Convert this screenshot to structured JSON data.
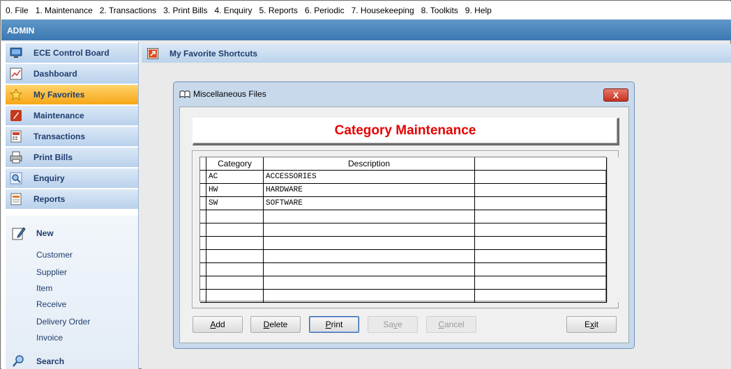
{
  "menu": {
    "items": [
      "0. File",
      "1. Maintenance",
      "2. Transactions",
      "3. Print Bills",
      "4. Enquiry",
      "5. Reports",
      "6. Periodic",
      "7. Housekeeping",
      "8. Toolkits",
      "9. Help"
    ]
  },
  "user_bar": {
    "username": "ADMIN"
  },
  "sidebar": {
    "items": [
      {
        "label": "ECE Control Board",
        "icon": "monitor-icon",
        "active": false
      },
      {
        "label": "Dashboard",
        "icon": "chart-icon",
        "active": false
      },
      {
        "label": "My Favorites",
        "icon": "star-icon",
        "active": true
      },
      {
        "label": "Maintenance",
        "icon": "wrench-icon",
        "active": false
      },
      {
        "label": "Transactions",
        "icon": "calculator-icon",
        "active": false
      },
      {
        "label": "Print Bills",
        "icon": "printer-icon",
        "active": false
      },
      {
        "label": "Enquiry",
        "icon": "magnifier-icon",
        "active": false
      },
      {
        "label": "Reports",
        "icon": "report-icon",
        "active": false
      }
    ],
    "new_section": {
      "title": "New",
      "links": [
        "Customer",
        "Supplier",
        "Item",
        "Receive",
        "Delivery Order",
        "Invoice"
      ]
    },
    "search_label": "Search"
  },
  "main": {
    "header_title": "My Favorite Shortcuts"
  },
  "dialog": {
    "title": "Miscellaneous Files",
    "close_label": "X",
    "form_title": "Category Maintenance",
    "columns": [
      "Category",
      "Description"
    ],
    "rows": [
      {
        "category": "AC",
        "description": "ACCESSORIES"
      },
      {
        "category": "HW",
        "description": "HARDWARE"
      },
      {
        "category": "SW",
        "description": "SOFTWARE"
      }
    ],
    "buttons": {
      "add": {
        "pre": "",
        "key": "A",
        "post": "dd"
      },
      "delete": {
        "pre": "",
        "key": "D",
        "post": "elete"
      },
      "print": {
        "pre": "",
        "key": "P",
        "post": "rint"
      },
      "save": {
        "pre": "Sa",
        "key": "v",
        "post": "e"
      },
      "cancel": {
        "pre": "",
        "key": "C",
        "post": "ancel"
      },
      "exit": {
        "pre": "E",
        "key": "x",
        "post": "it"
      }
    }
  },
  "colors": {
    "accent_blue": "#3c78b2",
    "active_orange": "#f6a716",
    "title_red": "#e60000",
    "nav_text": "#1f3d6d"
  }
}
